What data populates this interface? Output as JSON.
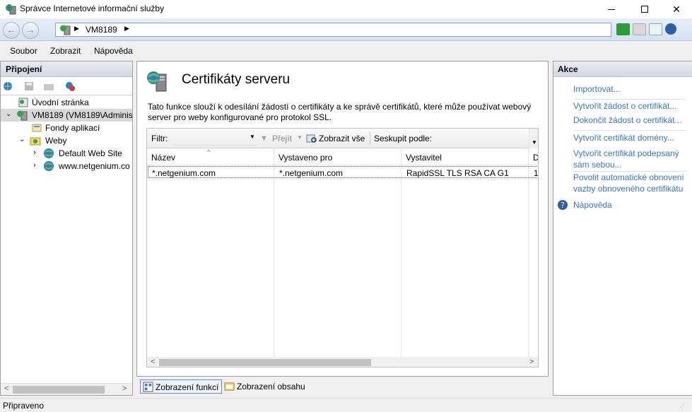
{
  "window": {
    "title": "Správce Internetové informační služby"
  },
  "nav": {
    "breadcrumb": "VM8189"
  },
  "menu": {
    "items": [
      "Soubor",
      "Zobrazit",
      "Nápověda"
    ]
  },
  "connections": {
    "title": "Připojení",
    "tree": [
      {
        "label": "Úvodní stránka",
        "icon": "start-page-icon",
        "expander": ""
      },
      {
        "label": "VM8189 (VM8189\\Administ",
        "icon": "server-icon",
        "expander": "⌄"
      },
      {
        "label": "Fondy aplikací",
        "icon": "app-pools-icon",
        "expander": ""
      },
      {
        "label": "Weby",
        "icon": "sites-folder-icon",
        "expander": "⌄"
      },
      {
        "label": "Default Web Site",
        "icon": "globe-icon",
        "expander": "›"
      },
      {
        "label": "www.netgenium.co",
        "icon": "globe-icon",
        "expander": "›"
      }
    ]
  },
  "content": {
    "title": "Certifikáty serveru",
    "description": "Tato funkce slouží k odesílání žádostí o certifikáty a ke správě certifikátů, které může používat webový server pro weby konfigurované pro protokol SSL.",
    "filter_label": "Filtr:",
    "go_label": "Přejít",
    "show_all_label": "Zobrazit vše",
    "group_by_label": "Seskupit podle:",
    "columns": [
      "Název",
      "Vystaveno pro",
      "Vystavitel",
      "D"
    ],
    "rows": [
      [
        "*.netgenium.com",
        "*.netgenium.com",
        "RapidSSL TLS RSA CA G1",
        "1"
      ]
    ]
  },
  "view_tabs": {
    "features": "Zobrazení funkcí",
    "content": "Zobrazení obsahu"
  },
  "actions": {
    "title": "Akce",
    "group1": [
      "Importovat..."
    ],
    "group2": [
      "Vytvořit žádost o certifikát...",
      "Dokončit žádost o certifikát..."
    ],
    "group3": [
      "Vytvořit certifikát domény...",
      "Vytvořit certifikát podepsaný sám sebou..."
    ],
    "group4": [
      "Povolit automatické obnovení vazby obnoveného certifikátu"
    ],
    "help": "Nápověda"
  },
  "status": {
    "text": "Připraveno"
  },
  "colors": {
    "link": "#3874c8",
    "pane_header": "#dde3ea"
  }
}
